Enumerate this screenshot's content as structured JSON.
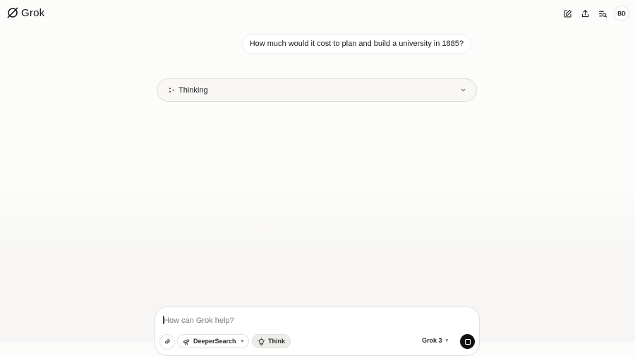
{
  "app": {
    "name": "Grok"
  },
  "header": {
    "icons": [
      "new-chat-icon",
      "share-icon",
      "history-search-icon"
    ],
    "avatar_initials": "BD"
  },
  "conversation": {
    "user_message": "How much would it cost to plan and build a university in 1885?",
    "thinking_label": "Thinking"
  },
  "composer": {
    "placeholder": "How can Grok help?",
    "deepsearch_label": "DeeperSearch",
    "think_label": "Think",
    "model_label": "Grok 3"
  },
  "colors": {
    "background": "#fcfcfb",
    "send": "#111111",
    "think_active": "#eeede9"
  }
}
